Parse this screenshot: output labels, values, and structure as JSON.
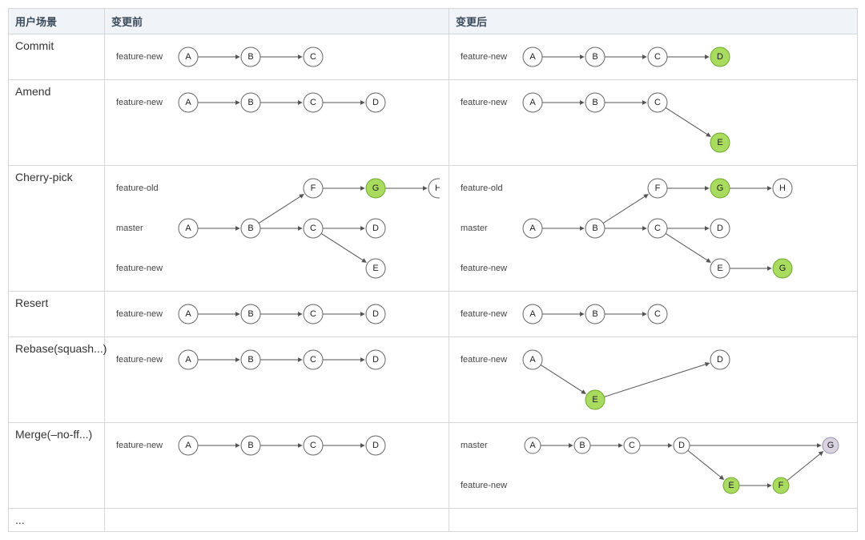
{
  "headers": {
    "scene": "用户场景",
    "before": "变更前",
    "after": "变更后"
  },
  "colors": {
    "green": "#a8db5e",
    "grey": "#d9d4e0",
    "white": "#ffffff"
  },
  "rows": [
    {
      "scene": "Commit",
      "before": {
        "branches": [
          "feature-new"
        ],
        "lanes": {
          "feature-new": {
            "y": 0,
            "nodes": [
              "A",
              "B",
              "C"
            ]
          }
        },
        "edges": [
          [
            "A",
            "B"
          ],
          [
            "B",
            "C"
          ]
        ]
      },
      "after": {
        "branches": [
          "feature-new"
        ],
        "lanes": {
          "feature-new": {
            "y": 0,
            "nodes": [
              "A",
              "B",
              "C",
              "D"
            ]
          }
        },
        "edges": [
          [
            "A",
            "B"
          ],
          [
            "B",
            "C"
          ],
          [
            "C",
            "D"
          ]
        ],
        "highlight_green": [
          "D"
        ]
      }
    },
    {
      "scene": "Amend",
      "before": {
        "branches": [
          "feature-new"
        ],
        "lanes": {
          "feature-new": {
            "y": 0,
            "nodes": [
              "A",
              "B",
              "C",
              "D"
            ]
          }
        },
        "edges": [
          [
            "A",
            "B"
          ],
          [
            "B",
            "C"
          ],
          [
            "C",
            "D"
          ]
        ]
      },
      "after": {
        "branches": [
          "feature-new"
        ],
        "lanes": {
          "feature-new": {
            "y": 0,
            "nodes": [
              "A",
              "B",
              "C"
            ]
          },
          "_amend": {
            "y": 1,
            "nodes": [
              "E"
            ],
            "no_label": true,
            "offset": 3
          }
        },
        "edges": [
          [
            "A",
            "B"
          ],
          [
            "B",
            "C"
          ],
          [
            "C",
            "E"
          ]
        ],
        "highlight_green": [
          "E"
        ]
      }
    },
    {
      "scene": "Cherry-pick",
      "before": {
        "branches": [
          "feature-old",
          "master",
          "feature-new"
        ],
        "lanes": {
          "feature-old": {
            "y": 0,
            "nodes": [
              "F",
              "G",
              "H"
            ],
            "offset": 2
          },
          "master": {
            "y": 1,
            "nodes": [
              "A",
              "B",
              "C",
              "D"
            ]
          },
          "feature-new": {
            "y": 2,
            "nodes": [
              "E"
            ],
            "offset": 3
          }
        },
        "edges": [
          [
            "A",
            "B"
          ],
          [
            "B",
            "F"
          ],
          [
            "F",
            "G"
          ],
          [
            "G",
            "H"
          ],
          [
            "B",
            "C"
          ],
          [
            "C",
            "D"
          ],
          [
            "C",
            "E"
          ]
        ],
        "highlight_green": [
          "G"
        ]
      },
      "after": {
        "branches": [
          "feature-old",
          "master",
          "feature-new"
        ],
        "lanes": {
          "feature-old": {
            "y": 0,
            "nodes": [
              "F",
              "G",
              "H"
            ],
            "offset": 2
          },
          "master": {
            "y": 1,
            "nodes": [
              "A",
              "B",
              "C",
              "D"
            ]
          },
          "feature-new": {
            "y": 2,
            "nodes": [
              "E",
              "G2"
            ],
            "offset": 3
          }
        },
        "node_labels": {
          "G2": "G"
        },
        "edges": [
          [
            "A",
            "B"
          ],
          [
            "B",
            "F"
          ],
          [
            "F",
            "G"
          ],
          [
            "G",
            "H"
          ],
          [
            "B",
            "C"
          ],
          [
            "C",
            "D"
          ],
          [
            "C",
            "E"
          ],
          [
            "E",
            "G2"
          ]
        ],
        "highlight_green": [
          "G",
          "G2"
        ]
      }
    },
    {
      "scene": "Resert",
      "before": {
        "branches": [
          "feature-new"
        ],
        "lanes": {
          "feature-new": {
            "y": 0,
            "nodes": [
              "A",
              "B",
              "C",
              "D"
            ]
          }
        },
        "edges": [
          [
            "A",
            "B"
          ],
          [
            "B",
            "C"
          ],
          [
            "C",
            "D"
          ]
        ]
      },
      "after": {
        "branches": [
          "feature-new"
        ],
        "lanes": {
          "feature-new": {
            "y": 0,
            "nodes": [
              "A",
              "B",
              "C"
            ]
          }
        },
        "edges": [
          [
            "A",
            "B"
          ],
          [
            "B",
            "C"
          ]
        ]
      }
    },
    {
      "scene": "Rebase(squash...)",
      "before": {
        "branches": [
          "feature-new"
        ],
        "lanes": {
          "feature-new": {
            "y": 0,
            "nodes": [
              "A",
              "B",
              "C",
              "D"
            ]
          }
        },
        "edges": [
          [
            "A",
            "B"
          ],
          [
            "B",
            "C"
          ],
          [
            "C",
            "D"
          ]
        ]
      },
      "after": {
        "branches": [
          "feature-new"
        ],
        "lanes": {
          "feature-new": {
            "y": 0,
            "nodes": [
              "A",
              "D"
            ],
            "positions": {
              "A": 0,
              "D": 3
            }
          },
          "_squash": {
            "y": 1,
            "nodes": [
              "E"
            ],
            "no_label": true,
            "positions": {
              "E": 1
            }
          }
        },
        "edges": [
          [
            "A",
            "E"
          ],
          [
            "E",
            "D"
          ]
        ],
        "highlight_green": [
          "E"
        ]
      }
    },
    {
      "scene": "Merge(–no-ff...)",
      "before": {
        "branches": [
          "feature-new"
        ],
        "lanes": {
          "feature-new": {
            "y": 0,
            "nodes": [
              "A",
              "B",
              "C",
              "D"
            ]
          }
        },
        "edges": [
          [
            "A",
            "B"
          ],
          [
            "B",
            "C"
          ],
          [
            "C",
            "D"
          ]
        ]
      },
      "after": {
        "branches": [
          "master",
          "feature-new"
        ],
        "lanes": {
          "master": {
            "y": 0,
            "nodes": [
              "A",
              "B",
              "C",
              "D",
              "G"
            ],
            "positions": {
              "A": 0,
              "B": 1,
              "C": 2,
              "D": 3,
              "G": 6
            }
          },
          "feature-new": {
            "y": 1,
            "nodes": [
              "E",
              "F"
            ],
            "positions": {
              "E": 4,
              "F": 5
            }
          }
        },
        "small_nodes": true,
        "edges": [
          [
            "A",
            "B"
          ],
          [
            "B",
            "C"
          ],
          [
            "C",
            "D"
          ],
          [
            "D",
            "E"
          ],
          [
            "E",
            "F"
          ],
          [
            "F",
            "G"
          ],
          [
            "D",
            "G"
          ]
        ],
        "highlight_green": [
          "E",
          "F"
        ],
        "highlight_grey": [
          "G"
        ]
      }
    },
    {
      "scene": "...",
      "before": null,
      "after": null
    }
  ]
}
